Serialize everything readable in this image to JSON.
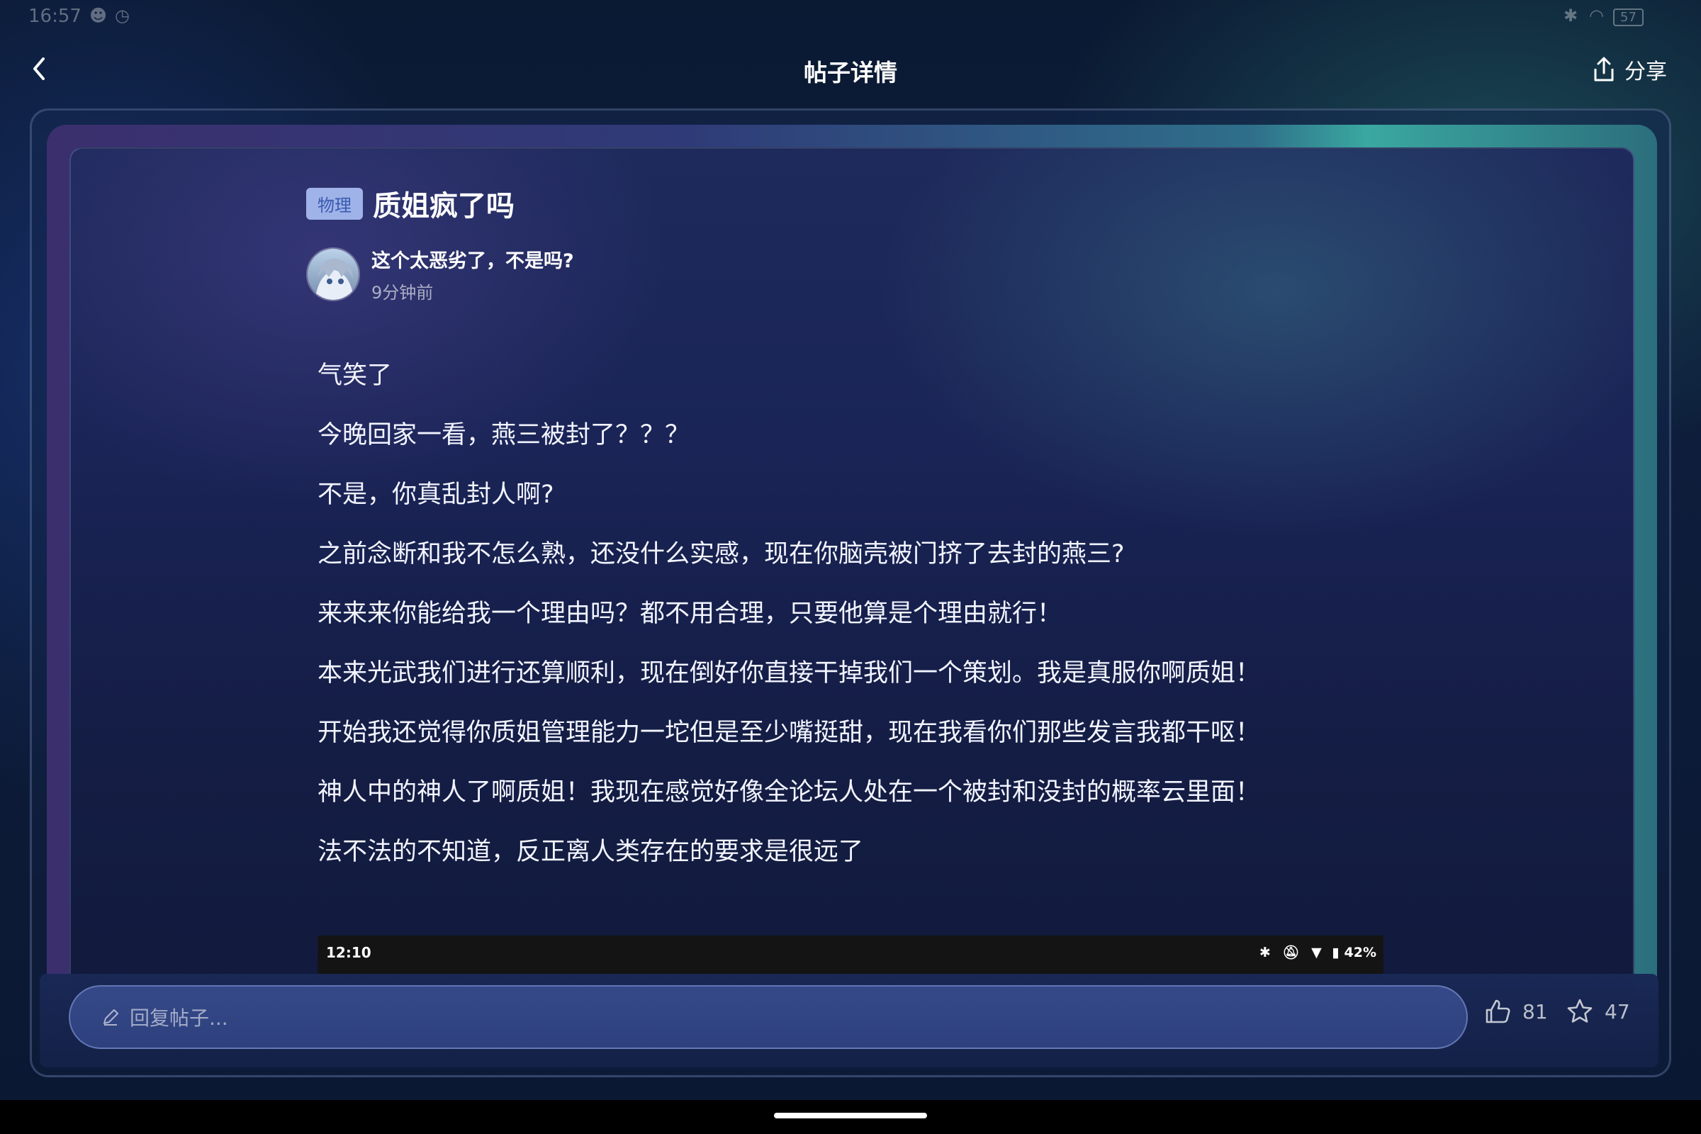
{
  "status_bar": {
    "time": "16:57",
    "battery": "57"
  },
  "header": {
    "title": "帖子详情",
    "share_label": "分享"
  },
  "post": {
    "tag": "物理",
    "title": "质姐疯了吗",
    "author": "这个太恶劣了，不是吗?",
    "time": "9分钟前",
    "paragraphs": [
      "气笑了",
      "今晚回家一看，燕三被封了？？？",
      "不是，你真乱封人啊?",
      "之前念断和我不怎么熟，还没什么实感，现在你脑壳被门挤了去封的燕三?",
      "来来来你能给我一个理由吗？都不用合理，只要他算是个理由就行！",
      "本来光武我们进行还算顺利，现在倒好你直接干掉我们一个策划。我是真服你啊质姐！",
      "开始我还觉得你质姐管理能力一坨但是至少嘴挺甜，现在我看你们那些发言我都干呕！",
      "神人中的神人了啊质姐！我现在感觉好像全论坛人处在一个被封和没封的概率云里面！",
      "法不法的不知道，反正离人类存在的要求是很远了"
    ]
  },
  "embedded_screenshot": {
    "time": "12:10",
    "battery": "42%"
  },
  "reply": {
    "placeholder": "回复帖子..."
  },
  "actions": {
    "likes": "81",
    "favorites": "47"
  },
  "colors": {
    "tag_bg": "#9fb3e8",
    "tag_text": "#3a5ab0",
    "accent_teal": "#3aa8a0"
  }
}
